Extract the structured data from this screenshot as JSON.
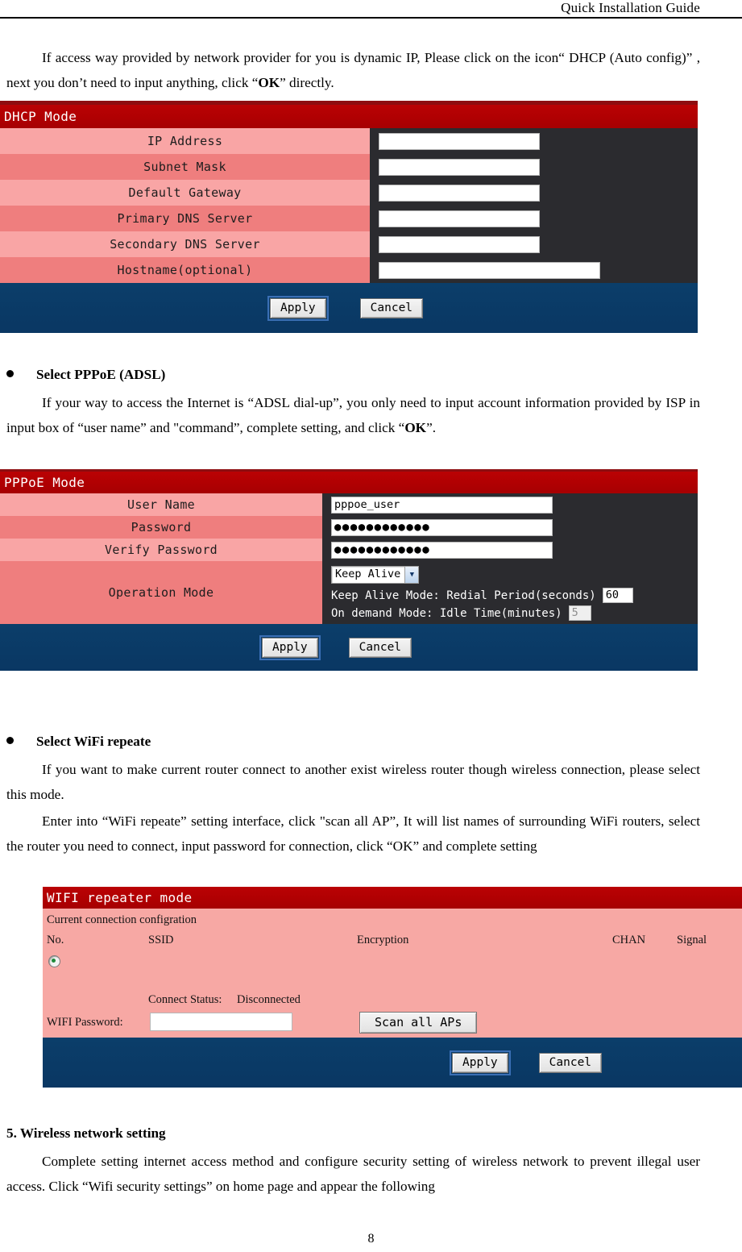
{
  "header": {
    "title": "Quick Installation Guide"
  },
  "page_number": "8",
  "intro": {
    "line": "If access way provided by network provider for you is dynamic IP, Please click on the icon“ DHCP (Auto config)” , next you don’t need to input anything, click “",
    "bold": "OK",
    "tail": "” directly."
  },
  "dhcp_panel": {
    "title": "DHCP Mode",
    "rows": [
      {
        "label": "IP Address",
        "value": ""
      },
      {
        "label": "Subnet Mask",
        "value": ""
      },
      {
        "label": "Default Gateway",
        "value": ""
      },
      {
        "label": "Primary DNS Server",
        "value": ""
      },
      {
        "label": "Secondary DNS Server",
        "value": ""
      },
      {
        "label": "Hostname(optional)",
        "value": ""
      }
    ],
    "apply_label": "Apply",
    "cancel_label": "Cancel"
  },
  "pppoe_section": {
    "bullet_title": "Select PPPoE (ADSL)",
    "body": "If your way to access the Internet is “ADSL dial-up”, you only need to input account information provided by ISP in input box of “user name” and \"command”, complete setting, and click “",
    "body_bold": "OK",
    "body_tail": "”."
  },
  "pppoe_panel": {
    "title": "PPPoE Mode",
    "rows": [
      {
        "label": "User Name",
        "value": "pppoe_user"
      },
      {
        "label": "Password",
        "value": "●●●●●●●●●●●●"
      },
      {
        "label": "Verify Password",
        "value": "●●●●●●●●●●●●"
      }
    ],
    "operation_mode_label": "Operation Mode",
    "operation_mode_selected": "Keep Alive",
    "keep_alive_label": "Keep Alive Mode: Redial Period(seconds)",
    "keep_alive_value": "60",
    "on_demand_label": "On demand Mode: Idle Time(minutes)",
    "on_demand_value": "5",
    "apply_label": "Apply",
    "cancel_label": "Cancel"
  },
  "wifi_section": {
    "bullet_title": "Select WiFi repeate",
    "para1": "If you want to make current router connect to another exist wireless router though wireless connection, please select this mode.",
    "para2": "Enter into “WiFi repeate” setting interface, click \"scan all AP”, It will list names of surrounding WiFi routers, select the router you need to connect, input password for connection, click “OK” and complete setting"
  },
  "wifi_panel": {
    "title": "WIFI repeater mode",
    "subtitle": "Current connection configration",
    "columns": [
      "No.",
      "SSID",
      "Encryption",
      "CHAN",
      "Signal"
    ],
    "connect_status_label": "Connect Status:",
    "connect_status_value": "Disconnected",
    "password_label": "WIFI Password:",
    "password_value": "",
    "scan_label": "Scan all APs",
    "apply_label": "Apply",
    "cancel_label": "Cancel"
  },
  "wireless_section": {
    "heading": "5. Wireless network setting",
    "body": "Complete setting internet access method and configure security setting of wireless network to prevent illegal user access. Click “Wifi security settings” on home page and appear the following"
  },
  "colors": {
    "title_red": "#b00002",
    "row_light": "#f9a5a5",
    "row_dark": "#ef7e7e",
    "panel_dark": "#2b2b2f",
    "footer_blue": "#0a3c66",
    "wifi_pink": "#f7a8a4",
    "radio_green": "#1f8a3a"
  }
}
